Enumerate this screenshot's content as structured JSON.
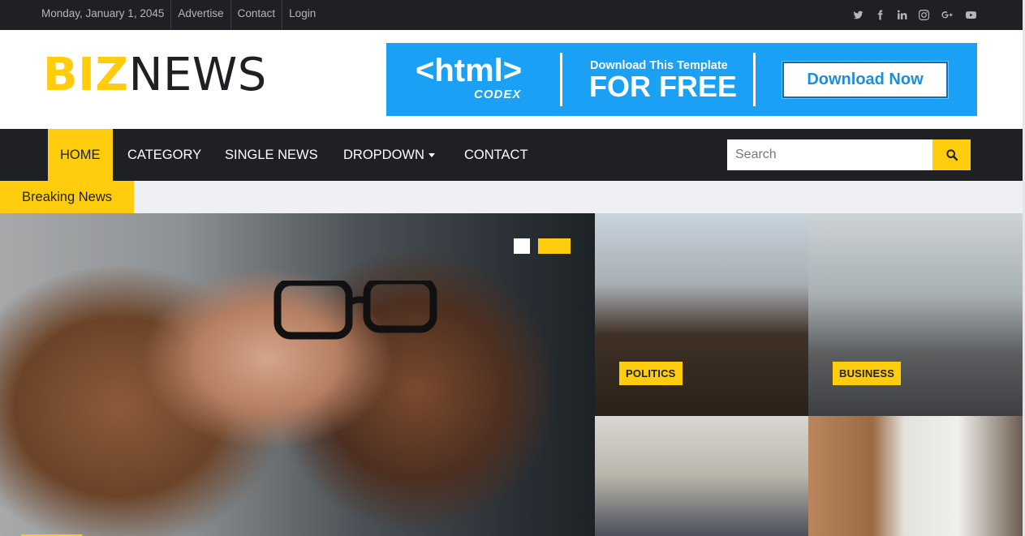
{
  "topbar": {
    "date": "Monday, January 1, 2045",
    "links": [
      "Advertise",
      "Contact",
      "Login"
    ],
    "social_icons": [
      "twitter-icon",
      "facebook-icon",
      "linkedin-icon",
      "instagram-icon",
      "google-plus-icon",
      "youtube-icon"
    ]
  },
  "logo": {
    "part1": "BIZ",
    "part2": "NEWS"
  },
  "banner": {
    "brand": "<html>",
    "brand_sub": "CODEX",
    "small_text": "Download This Template",
    "big_text": "FOR FREE",
    "button_label": "Download Now"
  },
  "nav": {
    "items": [
      {
        "label": "HOME",
        "active": true
      },
      {
        "label": "CATEGORY"
      },
      {
        "label": "SINGLE NEWS"
      },
      {
        "label": "DROPDOWN"
      },
      {
        "label": "CONTACT"
      }
    ],
    "search_placeholder": "Search"
  },
  "breaking": {
    "label": "Breaking News"
  },
  "tiles": [
    {
      "badge": "POLITICS"
    },
    {
      "badge": "BUSINESS"
    }
  ],
  "colors": {
    "accent": "#ffcc0e",
    "dark": "#1e2024",
    "banner_blue": "#1aa0f5"
  }
}
